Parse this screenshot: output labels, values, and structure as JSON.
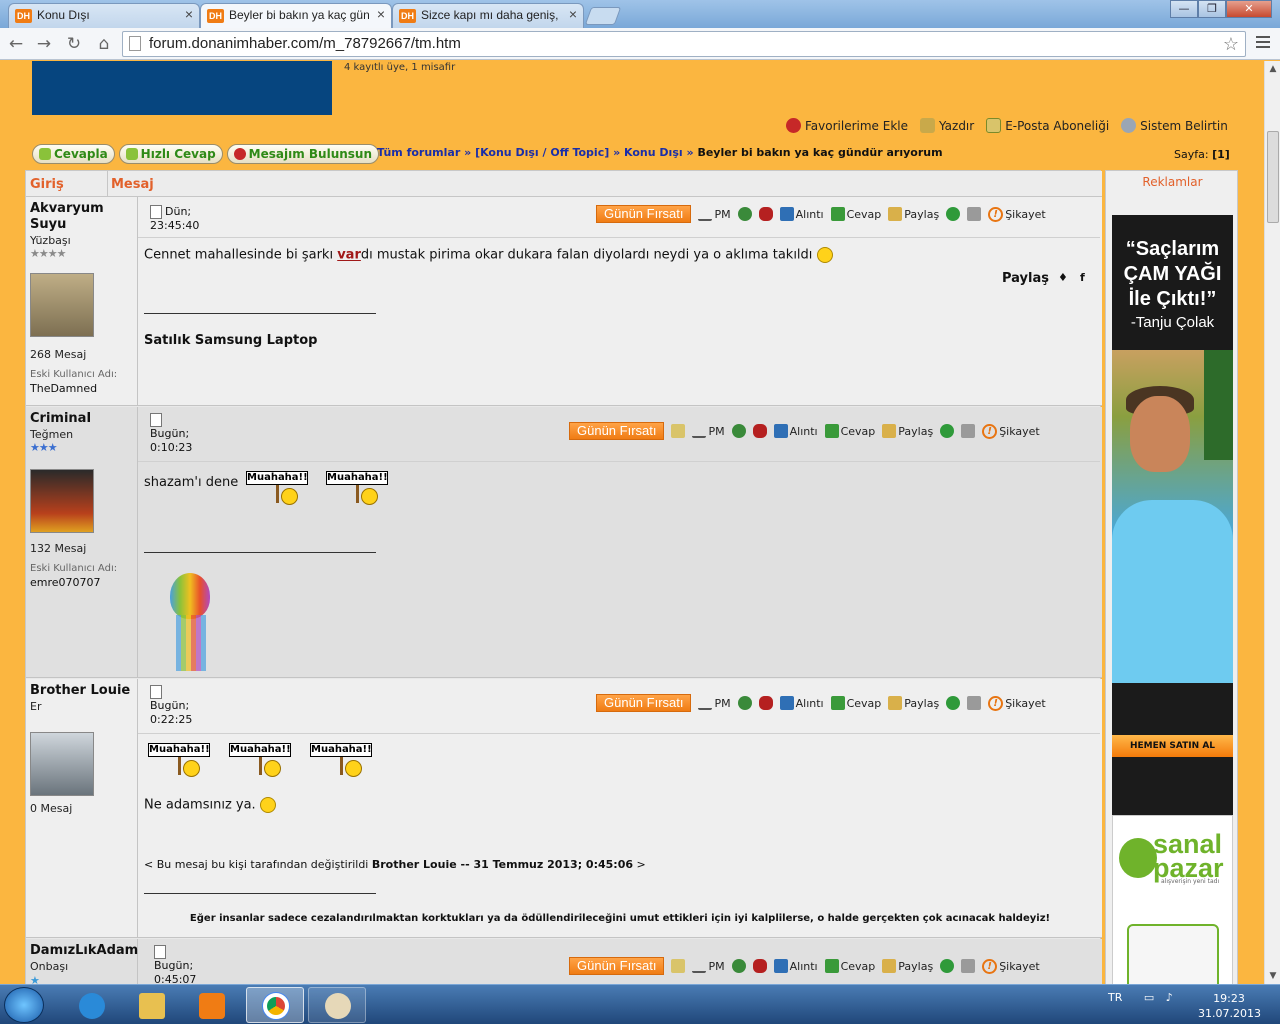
{
  "browser": {
    "tabs": [
      {
        "icon": "DH",
        "title": "Konu Dışı",
        "active": false
      },
      {
        "icon": "DH",
        "title": "Beyler bi bakın ya kaç gün",
        "active": true
      },
      {
        "icon": "DH",
        "title": "Sizce kapı mı daha geniş, k",
        "active": false
      }
    ],
    "url": "forum.donanimhaber.com/m_78792667/tm.htm",
    "window_controls": {
      "minimize": "—",
      "maximize": "❐",
      "close": "✕"
    }
  },
  "header": {
    "online": "4 kayıtlı üye, 1 misafir",
    "tools": [
      "Favorilerime Ekle",
      "Yazdır",
      "E-Posta Aboneliği",
      "Sistem Belirtin"
    ]
  },
  "buttons": [
    "Cevapla",
    "Hızlı Cevap",
    "Mesajım Bulunsun"
  ],
  "breadcrumb": {
    "items": [
      "Tüm forumlar",
      "[Konu Dışı / Off Topic]",
      "Konu Dışı"
    ],
    "separator": "»",
    "current": "Beyler bi bakın ya kaç gündür arıyorum"
  },
  "pagination": {
    "label": "Sayfa:",
    "value": "[1]"
  },
  "table_head": {
    "col1": "Giriş",
    "col2": "Mesaj"
  },
  "actions": {
    "deal": "Günün Fırsatı",
    "pm": "PM",
    "quote": "Alıntı",
    "reply": "Cevap",
    "share": "Paylaş",
    "report": "Şikayet"
  },
  "posts": [
    {
      "username": "Akvaryum Suyu",
      "rank": "Yüzbaşı",
      "stars": "★★★★",
      "count": "268 Mesaj",
      "old_label": "Eski Kullanıcı Adı:",
      "old_name": "TheDamned",
      "date_line1": "Dün;",
      "date_line2": "23:45:40",
      "text_before": "Cennet mahallesinde bi şarkı ",
      "text_link": "var",
      "text_after": "dı mustak pirima okar dukara falan diyolardı neydi ya o aklıma takıldı",
      "share_label": "Paylaş",
      "signature": "Satılık Samsung Laptop"
    },
    {
      "username": "CriminaI",
      "rank": "Teğmen",
      "stars": "★★★",
      "count": "132 Mesaj",
      "old_label": "Eski Kullanıcı Adı:",
      "old_name": "emre070707",
      "date_line1": "Bugün;",
      "date_line2": "0:10:23",
      "text": "shazam'ı dene",
      "muahaha": "Muahaha!!"
    },
    {
      "username": "Brother Louie",
      "rank": "Er",
      "count": "0 Mesaj",
      "date_line1": "Bugün;",
      "date_line2": "0:22:25",
      "muahaha": "Muahaha!!",
      "text": "Ne adamsınız ya.",
      "edit_prefix": "< Bu mesaj bu kişi tarafından değiştirildi",
      "edit_bold": "Brother Louie -- 31 Temmuz 2013; 0:45:06",
      "edit_suffix": ">",
      "signature": "Eğer insanlar sadece cezalandırılmaktan korktukları ya da ödüllendirileceğini umut ettikleri için iyi kalplilerse, o halde gerçekten çok acınacak haldeyiz!"
    },
    {
      "username": "DamızLıkAdam",
      "rank": "Onbaşı",
      "stars": "★",
      "date_line1": "Bugün;",
      "date_line2": "0:45:07"
    }
  ],
  "ads": {
    "label": "Reklamlar",
    "quote": "“Saçlarım ÇAM YAĞI İle Çıktı!”",
    "author": "-Tanju Çolak",
    "button": "HEMEN SATIN AL",
    "brand": "sanal pazar",
    "brand_tagline": "alışverişin yeni tadı"
  },
  "taskbar": {
    "lang": "TR",
    "time": "19:23",
    "date": "31.07.2013"
  },
  "colors": {
    "page_bg": "#fbb640",
    "header_accent": "#e2612b",
    "link": "#1a2ea8",
    "deal_button": "#f07c14"
  }
}
